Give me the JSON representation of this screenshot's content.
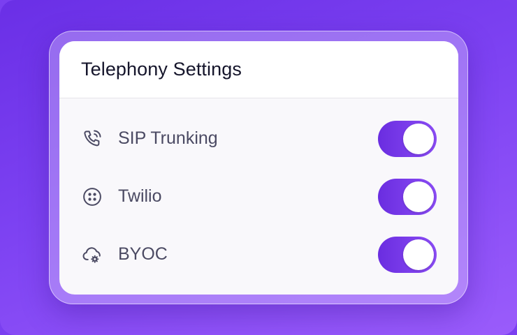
{
  "panel": {
    "title": "Telephony Settings"
  },
  "settings": [
    {
      "label": "SIP Trunking",
      "icon": "phone-call-icon",
      "enabled": true
    },
    {
      "label": "Twilio",
      "icon": "twilio-logo-icon",
      "enabled": true
    },
    {
      "label": "BYOC",
      "icon": "cloud-gear-icon",
      "enabled": true
    }
  ],
  "colors": {
    "background": "#7a3ff0",
    "toggle_on": "#7a3ceb",
    "title_text": "#15152b",
    "label_text": "#4b4a63"
  }
}
